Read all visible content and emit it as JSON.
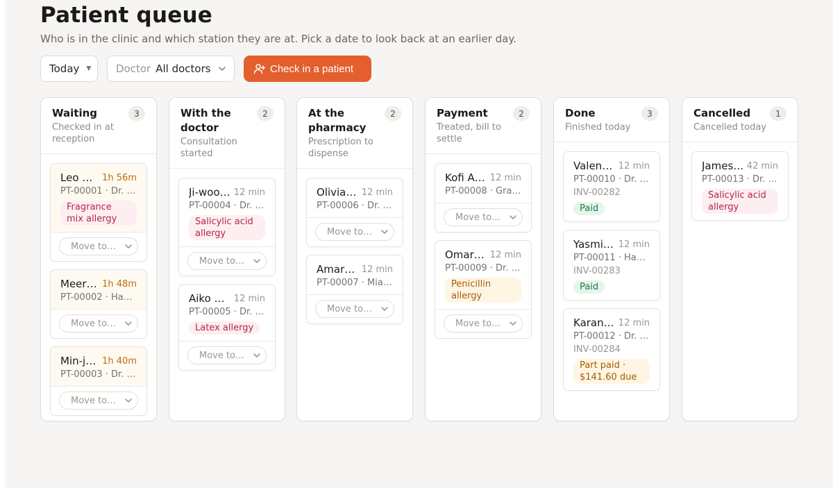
{
  "page": {
    "title": "Patient queue",
    "subtitle": "Who is in the clinic and which station they are at. Pick a date to look back at an earlier day."
  },
  "toolbar": {
    "date_value": "Today",
    "doctor_label": "Doctor",
    "doctor_value": "All doctors",
    "checkin_label": "Check in a patient"
  },
  "move_placeholder": "Move to…",
  "columns": [
    {
      "title": "Waiting",
      "subtitle": "Checked in at reception",
      "count": "3",
      "cards": [
        {
          "name": "Leo …",
          "wait": "1h 56m",
          "meta": "PT-00001 · Dr. …",
          "tag": "Fragrance mix allergy",
          "tag_type": "allergy",
          "warn": true
        },
        {
          "name": "Meer…",
          "wait": "1h 48m",
          "meta": "PT-00002 · Han…",
          "warn": true
        },
        {
          "name": "Min-j…",
          "wait": "1h 40m",
          "meta": "PT-00003 · Dr. …",
          "warn": true
        }
      ]
    },
    {
      "title": "With the doctor",
      "subtitle": "Consultation started",
      "count": "2",
      "cards": [
        {
          "name": "Ji-woo…",
          "wait": "12 min",
          "meta": "PT-00004 · Dr. …",
          "tag": "Salicylic acid allergy",
          "tag_type": "allergy"
        },
        {
          "name": "Aiko …",
          "wait": "12 min",
          "meta": "PT-00005 · Dr. L…",
          "tag": "Latex allergy",
          "tag_type": "allergy short"
        }
      ]
    },
    {
      "title": "At the pharmacy",
      "subtitle": "Prescription to dispense",
      "count": "2",
      "cards": [
        {
          "name": "Olivia…",
          "wait": "12 min",
          "meta": "PT-00006 · Dr. …"
        },
        {
          "name": "Amar…",
          "wait": "12 min",
          "meta": "PT-00007 · Mia …"
        }
      ]
    },
    {
      "title": "Payment",
      "subtitle": "Treated, bill to settle",
      "count": "2",
      "cards": [
        {
          "name": "Kofi A…",
          "wait": "12 min",
          "meta": "PT-00008 · Gra…"
        },
        {
          "name": "Omar…",
          "wait": "12 min",
          "meta": "PT-00009 · Dr. …",
          "tag": "Penicillin allergy",
          "tag_type": "penicillin"
        }
      ]
    },
    {
      "title": "Done",
      "subtitle": "Finished today",
      "count": "3",
      "cards": [
        {
          "name": "Valen…",
          "wait": "12 min",
          "meta": "PT-00010 · Dr. …",
          "invoice": "INV-00282",
          "tag": "Paid",
          "tag_type": "paid",
          "no_move": true
        },
        {
          "name": "Yasmi…",
          "wait": "12 min",
          "meta": "PT-00011 · Han…",
          "invoice": "INV-00283",
          "tag": "Paid",
          "tag_type": "paid",
          "no_move": true
        },
        {
          "name": "Karan…",
          "wait": "12 min",
          "meta": "PT-00012 · Dr. …",
          "invoice": "INV-00284",
          "tag": "Part paid · $141.60 due",
          "tag_type": "partpaid",
          "no_move": true
        }
      ]
    },
    {
      "title": "Cancelled",
      "subtitle": "Cancelled today",
      "count": "1",
      "cards": [
        {
          "name": "James…",
          "wait": "42 min",
          "meta": "PT-00013 · Dr. …",
          "tag": "Salicylic acid allergy",
          "tag_type": "allergy",
          "no_move": true
        }
      ]
    }
  ],
  "colors": {
    "accent": "#e35f2d",
    "allergy_bg": "#fdeef1",
    "allergy_text": "#b3264a",
    "paid_bg": "#e6f5ec",
    "paid_text": "#1a7a45",
    "warning_text": "#c06a0a"
  },
  "icons": {
    "date_caret": "caret-down-icon",
    "doctor_caret": "chevron-down-icon",
    "checkin": "user-plus-icon",
    "move_caret": "chevron-down-icon"
  }
}
